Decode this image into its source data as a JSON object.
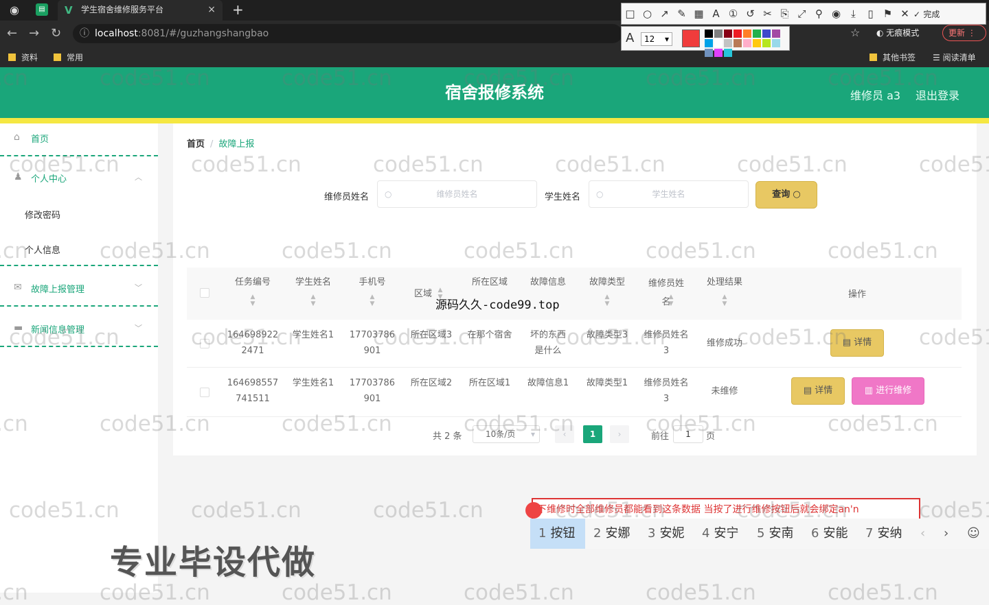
{
  "browser": {
    "tab_title": "学生宿舍维修服务平台",
    "tab_close": "×",
    "new_tab": "+",
    "url_host": "localhost",
    "url_rest": ":8081/#/guzhangshangbao",
    "bookmarks": [
      "资料",
      "常用"
    ],
    "bookmarks_right": [
      "其他书签",
      "阅读清单"
    ],
    "incognito": "无痕模式",
    "update": "更新"
  },
  "screenshot_tool": {
    "done": "完成",
    "font_size": "12",
    "swatches": [
      "#000000",
      "#7f7f7f",
      "#880015",
      "#ed1c24",
      "#ff7f27",
      "#22b14c",
      "#3f48cc",
      "#a349a4",
      "#00a2e8",
      "#ffffff",
      "#c3c3c3",
      "#b97a57",
      "#ffaec9",
      "#ffc90e",
      "#b5e61d",
      "#99d9ea",
      "#7092be",
      "#e040fb",
      "#26c6da"
    ],
    "accent": "#f03c3c"
  },
  "header": {
    "title": "宿舍报修系统",
    "user": "维修员 a3",
    "logout": "退出登录",
    "color": "#1aa67a"
  },
  "sidebar": {
    "home": "首页",
    "personal": "个人中心",
    "change_password": "修改密码",
    "personal_info": "个人信息",
    "fault_mgmt": "故障上报管理",
    "news_mgmt": "新闻信息管理"
  },
  "breadcrumb": {
    "home": "首页",
    "sep": "/",
    "current": "故障上报"
  },
  "search": {
    "label1": "维修员姓名",
    "placeholder1": "维修员姓名",
    "label2": "学生姓名",
    "placeholder2": "学生姓名",
    "button": "查询"
  },
  "table": {
    "headers": [
      "任务编号",
      "学生姓名",
      "手机号",
      "区域",
      "所在区域",
      "故障信息",
      "故障类型",
      "维修员姓名",
      "处理结果",
      "操作"
    ],
    "rows": [
      {
        "id": "1646989222471",
        "student": "学生姓名1",
        "phone": "17703786901",
        "area": "所在区域3",
        "location": "在那个宿舍",
        "info": "坏的东西是什么",
        "type": "故障类型3",
        "repairman": "维修员姓名3",
        "result": "维修成功",
        "actions": [
          "详情"
        ]
      },
      {
        "id": "1646985577415​11",
        "student": "学生姓名1",
        "phone": "17703786901",
        "area": "所在区域2",
        "location": "所在区域1",
        "info": "故障信息1",
        "type": "故障类型1",
        "repairman": "维修员姓名3",
        "result": "未维修",
        "actions": [
          "详情",
          "进行维修"
        ]
      }
    ]
  },
  "pagination": {
    "total": "共 2 条",
    "page_size": "10条/页",
    "current": "1",
    "goto": "前往",
    "goto_value": "1",
    "page_unit": "页"
  },
  "overlay_text": "源码久久-code99.top",
  "ime": {
    "input": "下维修时全部维修员都能看到这条数据 当按了进行维修按钮后就会绑定an'n",
    "candidates": [
      {
        "n": "1",
        "w": "按钮"
      },
      {
        "n": "2",
        "w": "安娜"
      },
      {
        "n": "3",
        "w": "安妮"
      },
      {
        "n": "4",
        "w": "安宁"
      },
      {
        "n": "5",
        "w": "安南"
      },
      {
        "n": "6",
        "w": "安能"
      },
      {
        "n": "7",
        "w": "安纳"
      }
    ]
  },
  "promo": "专业毕设代做",
  "watermark": "code51.cn"
}
